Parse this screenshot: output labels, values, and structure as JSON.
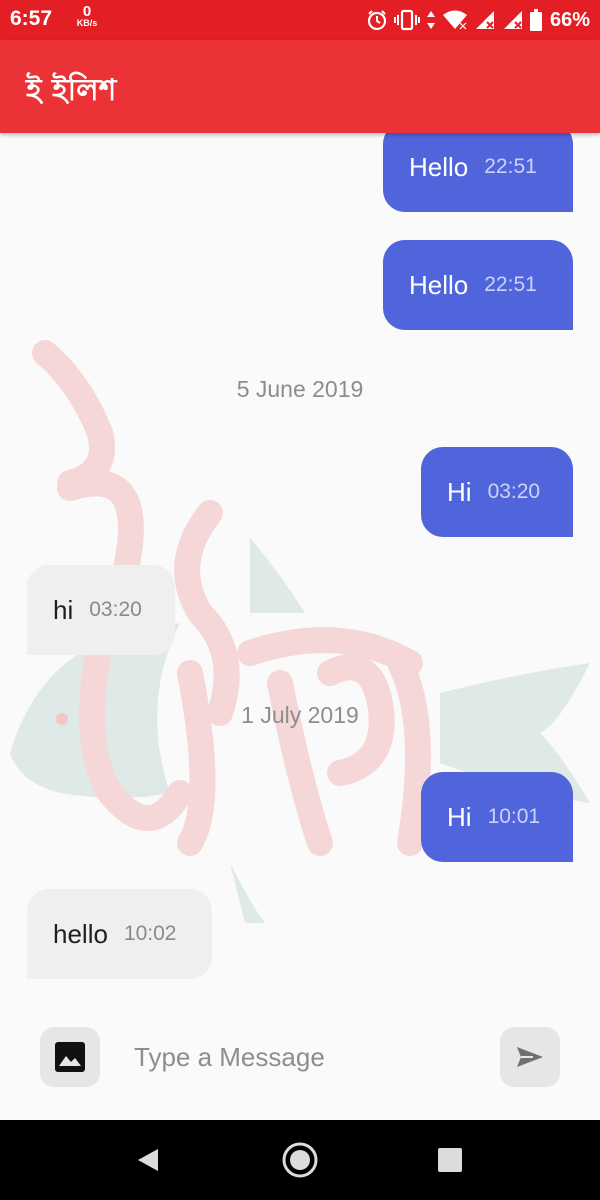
{
  "status_bar": {
    "time": "6:57",
    "net_speed_value": "0",
    "net_speed_unit": "KB/s",
    "battery": "66%",
    "icons": [
      "alarm-icon",
      "vibrate-icon",
      "data-arrows-icon",
      "wifi-icon",
      "signal-icon",
      "signal-icon",
      "battery-icon"
    ]
  },
  "app_bar": {
    "title": "ই ইলিশ"
  },
  "messages": [
    {
      "type": "out",
      "text": "Hello",
      "time": "22:51"
    },
    {
      "type": "out",
      "text": "Hello",
      "time": "22:51"
    },
    {
      "type": "date",
      "text": "5 June 2019"
    },
    {
      "type": "out",
      "text": "Hi",
      "time": "03:20"
    },
    {
      "type": "in",
      "text": "hi",
      "time": "03:20"
    },
    {
      "type": "date",
      "text": "1 July 2019"
    },
    {
      "type": "out",
      "text": "Hi",
      "time": "10:01"
    },
    {
      "type": "in",
      "text": "hello",
      "time": "10:02"
    }
  ],
  "input": {
    "placeholder": "Type a Message",
    "value": ""
  },
  "colors": {
    "status_bar": "#e41e25",
    "app_bar": "#eb3337",
    "outgoing_bubble": "#5064db",
    "incoming_bubble": "#efefef"
  }
}
